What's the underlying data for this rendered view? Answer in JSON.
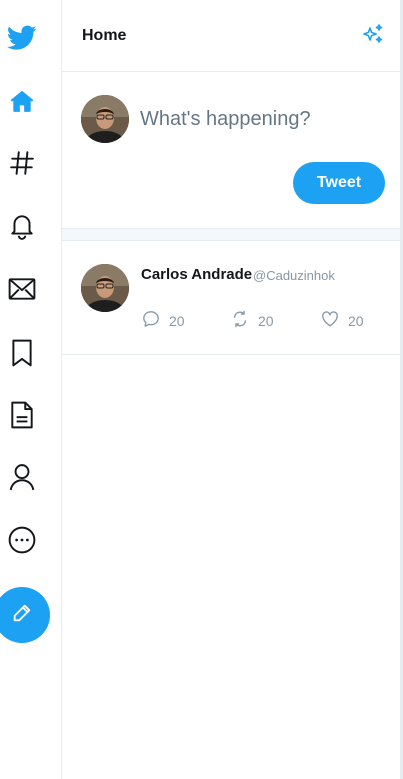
{
  "sidebar": {
    "items": [
      {
        "icon": "twitter-logo-icon",
        "color": "#1da1f2"
      },
      {
        "icon": "home-icon",
        "color": "#1da1f2"
      },
      {
        "icon": "hashtag-icon"
      },
      {
        "icon": "bell-icon"
      },
      {
        "icon": "envelope-icon"
      },
      {
        "icon": "bookmark-icon"
      },
      {
        "icon": "document-icon"
      },
      {
        "icon": "user-icon"
      },
      {
        "icon": "more-icon"
      }
    ],
    "compose_icon": "pencil-icon"
  },
  "header": {
    "title": "Home",
    "action_icon": "sparkle-icon"
  },
  "composer": {
    "placeholder": "What's happening?",
    "tweet_button": "Tweet"
  },
  "feed": [
    {
      "author": "Carlos Andrade",
      "handle": "@Caduzinhok",
      "replies": "20",
      "retweets": "20",
      "likes": "20"
    }
  ],
  "colors": {
    "accent": "#1da1f2",
    "muted": "#8899a6",
    "border": "#e6ecf0"
  }
}
